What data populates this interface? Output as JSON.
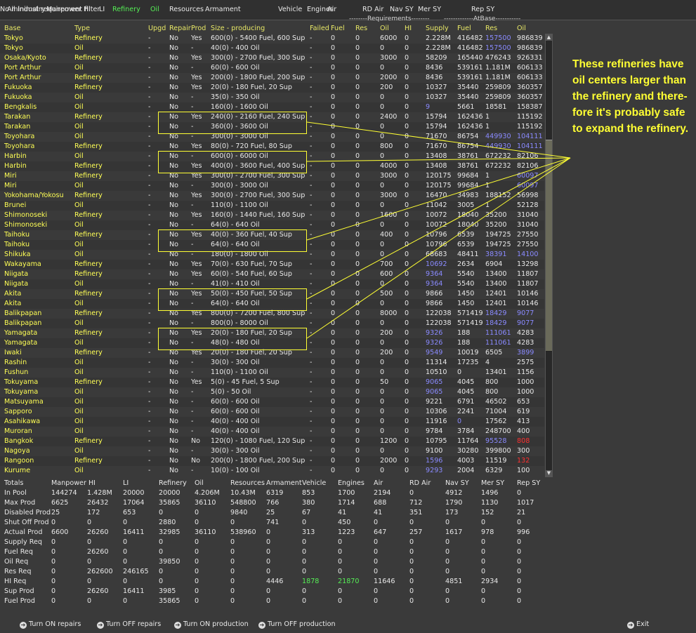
{
  "tabs": [
    "All Industry",
    "Manpower HI",
    "LI",
    "Refinery",
    "Oil",
    "Resources",
    "Armament",
    "Vehicle",
    "Engines",
    "Air",
    "RD Air",
    "Nav SY",
    "Mer SY",
    "Rep SY",
    "No minimal requirement filter"
  ],
  "requirements_header": "--------Requirements--------",
  "atbase_header": "-------------AtBase-----------",
  "columns": [
    "Base",
    "Type",
    "Upgd",
    "Repair",
    "Prod",
    "Size - producing",
    "Failed",
    "Fuel",
    "Res",
    "Oil",
    "HI",
    "Supply",
    "Fuel",
    "Res",
    "Oil"
  ],
  "rows": [
    [
      "Tokyo",
      "Refinery",
      "-",
      "No",
      "Yes",
      "600(0) - 5400 Fuel, 600 Sup",
      "-",
      "0",
      "0",
      "6000",
      "0",
      "2.228M",
      "416482",
      "157500",
      "986839"
    ],
    [
      "Tokyo",
      "Oil",
      "-",
      "No",
      "-",
      "40(0) - 400 Oil",
      "-",
      "0",
      "0",
      "0",
      "0",
      "2.228M",
      "416482",
      "157500",
      "986839"
    ],
    [
      "Osaka/Kyoto",
      "Refinery",
      "-",
      "No",
      "Yes",
      "300(0) - 2700 Fuel, 300 Sup",
      "-",
      "0",
      "0",
      "3000",
      "0",
      "58209",
      "165440",
      "476243",
      "926331"
    ],
    [
      "Port Arthur",
      "Oil",
      "-",
      "No",
      "-",
      "60(0) - 600 Oil",
      "-",
      "0",
      "0",
      "0",
      "0",
      "8436",
      "539161",
      "1.181M",
      "606133"
    ],
    [
      "Port Arthur",
      "Refinery",
      "-",
      "No",
      "Yes",
      "200(0) - 1800 Fuel, 200 Sup",
      "-",
      "0",
      "0",
      "2000",
      "0",
      "8436",
      "539161",
      "1.181M",
      "606133"
    ],
    [
      "Fukuoka",
      "Refinery",
      "-",
      "No",
      "Yes",
      "20(0) - 180 Fuel, 20 Sup",
      "-",
      "0",
      "0",
      "200",
      "0",
      "10327",
      "35440",
      "259809",
      "360357"
    ],
    [
      "Fukuoka",
      "Oil",
      "-",
      "No",
      "-",
      "35(0) - 350 Oil",
      "-",
      "0",
      "0",
      "0",
      "0",
      "10327",
      "35440",
      "259809",
      "360357"
    ],
    [
      "Bengkalis",
      "Oil",
      "-",
      "No",
      "-",
      "160(0) - 1600 Oil",
      "-",
      "0",
      "0",
      "0",
      "0",
      "9",
      "5661",
      "18581",
      "158387"
    ],
    [
      "Tarakan",
      "Refinery",
      "-",
      "No",
      "Yes",
      "240(0) - 2160 Fuel, 240 Sup",
      "-",
      "0",
      "0",
      "2400",
      "0",
      "15794",
      "162436",
      "1",
      "115192"
    ],
    [
      "Tarakan",
      "Oil",
      "-",
      "No",
      "-",
      "360(0) - 3600 Oil",
      "-",
      "0",
      "0",
      "0",
      "0",
      "15794",
      "162436",
      "1",
      "115192"
    ],
    [
      "Toyohara",
      "Oil",
      "-",
      "No",
      "-",
      "300(0) - 3000 Oil",
      "-",
      "0",
      "0",
      "0",
      "0",
      "71670",
      "86754",
      "449930",
      "104111"
    ],
    [
      "Toyohara",
      "Refinery",
      "-",
      "No",
      "Yes",
      "80(0) - 720 Fuel, 80 Sup",
      "-",
      "0",
      "0",
      "800",
      "0",
      "71670",
      "86754",
      "449930",
      "104111"
    ],
    [
      "Harbin",
      "Oil",
      "-",
      "No",
      "-",
      "600(0) - 6000 Oil",
      "-",
      "0",
      "0",
      "0",
      "0",
      "13408",
      "38761",
      "672232",
      "82106"
    ],
    [
      "Harbin",
      "Refinery",
      "-",
      "No",
      "Yes",
      "400(0) - 3600 Fuel, 400 Sup",
      "-",
      "0",
      "0",
      "4000",
      "0",
      "13408",
      "38761",
      "672232",
      "82106"
    ],
    [
      "Miri",
      "Refinery",
      "-",
      "No",
      "Yes",
      "300(0) - 2700 Fuel, 300 Sup",
      "-",
      "0",
      "0",
      "3000",
      "0",
      "120175",
      "99684",
      "1",
      "60097"
    ],
    [
      "Miri",
      "Oil",
      "-",
      "No",
      "-",
      "300(0) - 3000 Oil",
      "-",
      "0",
      "0",
      "0",
      "0",
      "120175",
      "99684",
      "1",
      "60097"
    ],
    [
      "Yokohama/Yokosu",
      "Refinery",
      "-",
      "No",
      "Yes",
      "300(0) - 2700 Fuel, 300 Sup",
      "-",
      "0",
      "0",
      "3000",
      "0",
      "16470",
      "34983",
      "188152",
      "56998"
    ],
    [
      "Brunei",
      "Oil",
      "-",
      "No",
      "-",
      "110(0) - 1100 Oil",
      "-",
      "0",
      "0",
      "0",
      "0",
      "11042",
      "3005",
      "1",
      "52128"
    ],
    [
      "Shimonoseki",
      "Refinery",
      "-",
      "No",
      "Yes",
      "160(0) - 1440 Fuel, 160 Sup",
      "-",
      "0",
      "0",
      "1600",
      "0",
      "10072",
      "18040",
      "35200",
      "31040"
    ],
    [
      "Shimonoseki",
      "Oil",
      "-",
      "No",
      "-",
      "64(0) - 640 Oil",
      "-",
      "0",
      "0",
      "0",
      "0",
      "10072",
      "18040",
      "35200",
      "31040"
    ],
    [
      "Taihoku",
      "Refinery",
      "-",
      "No",
      "Yes",
      "40(0) - 360 Fuel, 40 Sup",
      "-",
      "0",
      "0",
      "400",
      "0",
      "10796",
      "6539",
      "194725",
      "27550"
    ],
    [
      "Taihoku",
      "Oil",
      "-",
      "No",
      "-",
      "64(0) - 640 Oil",
      "-",
      "0",
      "0",
      "0",
      "0",
      "10796",
      "6539",
      "194725",
      "27550"
    ],
    [
      "Shikuka",
      "Oil",
      "-",
      "No",
      "-",
      "180(0) - 1800 Oil",
      "-",
      "0",
      "0",
      "0",
      "0",
      "68683",
      "48411",
      "38391",
      "14100"
    ],
    [
      "Wakayama",
      "Refinery",
      "-",
      "No",
      "Yes",
      "70(0) - 630 Fuel, 70 Sup",
      "-",
      "0",
      "0",
      "700",
      "0",
      "10692",
      "2634",
      "6904",
      "13298"
    ],
    [
      "Niigata",
      "Refinery",
      "-",
      "No",
      "Yes",
      "60(0) - 540 Fuel, 60 Sup",
      "-",
      "0",
      "0",
      "600",
      "0",
      "9364",
      "5540",
      "13400",
      "11807"
    ],
    [
      "Niigata",
      "Oil",
      "-",
      "No",
      "-",
      "41(0) - 410 Oil",
      "-",
      "0",
      "0",
      "0",
      "0",
      "9364",
      "5540",
      "13400",
      "11807"
    ],
    [
      "Akita",
      "Refinery",
      "-",
      "No",
      "Yes",
      "50(0) - 450 Fuel, 50 Sup",
      "-",
      "0",
      "0",
      "500",
      "0",
      "9866",
      "1450",
      "12401",
      "10146"
    ],
    [
      "Akita",
      "Oil",
      "-",
      "No",
      "-",
      "64(0) - 640 Oil",
      "-",
      "0",
      "0",
      "0",
      "0",
      "9866",
      "1450",
      "12401",
      "10146"
    ],
    [
      "Balikpapan",
      "Refinery",
      "-",
      "No",
      "Yes",
      "800(0) - 7200 Fuel, 800 Sup",
      "-",
      "0",
      "0",
      "8000",
      "0",
      "122038",
      "571419",
      "18429",
      "9077"
    ],
    [
      "Balikpapan",
      "Oil",
      "-",
      "No",
      "-",
      "800(0) - 8000 Oil",
      "-",
      "0",
      "0",
      "0",
      "0",
      "122038",
      "571419",
      "18429",
      "9077"
    ],
    [
      "Yamagata",
      "Refinery",
      "-",
      "No",
      "Yes",
      "20(0) - 180 Fuel, 20 Sup",
      "-",
      "0",
      "0",
      "200",
      "0",
      "9326",
      "188",
      "111061",
      "4283"
    ],
    [
      "Yamagata",
      "Oil",
      "-",
      "No",
      "-",
      "48(0) - 480 Oil",
      "-",
      "0",
      "0",
      "0",
      "0",
      "9326",
      "188",
      "111061",
      "4283"
    ],
    [
      "Iwaki",
      "Refinery",
      "-",
      "No",
      "Yes",
      "20(0) - 180 Fuel, 20 Sup",
      "-",
      "0",
      "0",
      "200",
      "0",
      "9549",
      "10019",
      "6505",
      "3899"
    ],
    [
      "Rashin",
      "Oil",
      "-",
      "No",
      "-",
      "30(0) - 300 Oil",
      "-",
      "0",
      "0",
      "0",
      "0",
      "11314",
      "17235",
      "4",
      "2575"
    ],
    [
      "Fushun",
      "Oil",
      "-",
      "No",
      "-",
      "110(0) - 1100 Oil",
      "-",
      "0",
      "0",
      "0",
      "0",
      "10510",
      "0",
      "13401",
      "1156"
    ],
    [
      "Tokuyama",
      "Refinery",
      "-",
      "No",
      "Yes",
      "5(0) - 45 Fuel, 5 Sup",
      "-",
      "0",
      "0",
      "50",
      "0",
      "9065",
      "4045",
      "800",
      "1000"
    ],
    [
      "Tokuyama",
      "Oil",
      "-",
      "No",
      "-",
      "5(0) - 50 Oil",
      "-",
      "0",
      "0",
      "0",
      "0",
      "9065",
      "4045",
      "800",
      "1000"
    ],
    [
      "Matsuyama",
      "Oil",
      "-",
      "No",
      "-",
      "60(0) - 600 Oil",
      "-",
      "0",
      "0",
      "0",
      "0",
      "9221",
      "6791",
      "46502",
      "653"
    ],
    [
      "Sapporo",
      "Oil",
      "-",
      "No",
      "-",
      "60(0) - 600 Oil",
      "-",
      "0",
      "0",
      "0",
      "0",
      "10306",
      "2241",
      "71004",
      "619"
    ],
    [
      "Asahikawa",
      "Oil",
      "-",
      "No",
      "-",
      "40(0) - 400 Oil",
      "-",
      "0",
      "0",
      "0",
      "0",
      "11916",
      "0",
      "17562",
      "413"
    ],
    [
      "Muroran",
      "Oil",
      "-",
      "No",
      "-",
      "40(0) - 400 Oil",
      "-",
      "0",
      "0",
      "0",
      "0",
      "9784",
      "3784",
      "248700",
      "400"
    ],
    [
      "Bangkok",
      "Refinery",
      "-",
      "No",
      "No",
      "120(0) - 1080 Fuel, 120 Sup",
      "-",
      "0",
      "0",
      "1200",
      "0",
      "10795",
      "11764",
      "95528",
      "808"
    ],
    [
      "Nagoya",
      "Oil",
      "-",
      "No",
      "-",
      "30(0) - 300 Oil",
      "-",
      "0",
      "0",
      "0",
      "0",
      "9100",
      "30280",
      "399800",
      "300"
    ],
    [
      "Rangoon",
      "Refinery",
      "-",
      "No",
      "No",
      "200(0) - 1800 Fuel, 200 Sup",
      "-",
      "0",
      "0",
      "2000",
      "0",
      "1596",
      "4003",
      "11519",
      "132"
    ],
    [
      "Kurume",
      "Oil",
      "-",
      "No",
      "-",
      "10(0) - 100 Oil",
      "-",
      "0",
      "0",
      "0",
      "0",
      "9293",
      "2004",
      "6329",
      "100"
    ]
  ],
  "blue_cells": [
    [
      7,
      11
    ],
    [
      30,
      11
    ],
    [
      31,
      11
    ],
    [
      32,
      11
    ],
    [
      35,
      11
    ],
    [
      36,
      11
    ],
    [
      43,
      11
    ],
    [
      44,
      11
    ],
    [
      23,
      11
    ],
    [
      24,
      11
    ],
    [
      25,
      11
    ],
    [
      39,
      12
    ],
    [
      0,
      13
    ],
    [
      1,
      13
    ],
    [
      10,
      13
    ],
    [
      11,
      13
    ],
    [
      22,
      13
    ],
    [
      28,
      13
    ],
    [
      29,
      13
    ],
    [
      30,
      13
    ],
    [
      31,
      13
    ],
    [
      41,
      13
    ],
    [
      10,
      14
    ],
    [
      11,
      14
    ],
    [
      14,
      14
    ],
    [
      15,
      14
    ],
    [
      22,
      14
    ],
    [
      28,
      14
    ],
    [
      29,
      14
    ],
    [
      32,
      14
    ]
  ],
  "red_cells": [
    [
      41,
      14
    ],
    [
      43,
      14
    ]
  ],
  "totals_columns": [
    "Totals",
    "Manpower HI",
    "LI",
    "Refinery",
    "Oil",
    "Resources",
    "Armament",
    "Vehicle",
    "Engines",
    "Air",
    "RD Air",
    "Nav SY",
    "Mer SY",
    "Rep SY"
  ],
  "totals_rows": [
    [
      "In Pool",
      "144274",
      "1.428M",
      "20000",
      "20000",
      "4.206M",
      "10.43M",
      "6319",
      "853",
      "1700",
      "2194",
      "0",
      "4912",
      "1496",
      "0"
    ],
    [
      "Max Prod",
      "6625",
      "26432",
      "17064",
      "35865",
      "36110",
      "548800",
      "766",
      "380",
      "1714",
      "688",
      "712",
      "1790",
      "1130",
      "1017"
    ],
    [
      "Disabled Prod",
      "25",
      "172",
      "653",
      "0",
      "0",
      "9840",
      "25",
      "67",
      "41",
      "41",
      "351",
      "173",
      "152",
      "21"
    ],
    [
      "Shut Off Prod",
      "0",
      "0",
      "0",
      "2880",
      "0",
      "0",
      "741",
      "0",
      "450",
      "0",
      "0",
      "0",
      "0",
      "0"
    ],
    [
      "Actual Prod",
      "6600",
      "26260",
      "16411",
      "32985",
      "36110",
      "538960",
      "0",
      "313",
      "1223",
      "647",
      "257",
      "1617",
      "978",
      "996"
    ],
    [
      "Supply Req",
      "0",
      "0",
      "0",
      "0",
      "0",
      "0",
      "0",
      "0",
      "0",
      "0",
      "0",
      "0",
      "0",
      "0"
    ],
    [
      "Fuel Req",
      "0",
      "26260",
      "0",
      "0",
      "0",
      "0",
      "0",
      "0",
      "0",
      "0",
      "0",
      "0",
      "0",
      "0"
    ],
    [
      "Oil Req",
      "0",
      "0",
      "0",
      "39850",
      "0",
      "0",
      "0",
      "0",
      "0",
      "0",
      "0",
      "0",
      "0",
      "0"
    ],
    [
      "Res Req",
      "0",
      "262600",
      "246165",
      "0",
      "0",
      "0",
      "0",
      "0",
      "0",
      "0",
      "0",
      "0",
      "0",
      "0"
    ],
    [
      "HI Req",
      "0",
      "0",
      "0",
      "0",
      "0",
      "0",
      "4446",
      "1878",
      "21870",
      "11646",
      "0",
      "4851",
      "2934",
      "0"
    ],
    [
      "Sup Prod",
      "0",
      "26260",
      "16411",
      "3985",
      "0",
      "0",
      "0",
      "0",
      "0",
      "0",
      "0",
      "0",
      "0",
      "0"
    ],
    [
      "Fuel Prod",
      "0",
      "0",
      "0",
      "35865",
      "0",
      "0",
      "0",
      "0",
      "0",
      "0",
      "0",
      "0",
      "0",
      "0"
    ]
  ],
  "annotation": "These refineries have oil centers larger than the refinery and there-fore it's probably safe to expand the refinery.",
  "buttons": {
    "repairs_on": "Turn ON repairs",
    "repairs_off": "Turn OFF repairs",
    "prod_on": "Turn ON production",
    "prod_off": "Turn OFF production",
    "exit": "Exit"
  },
  "colors": {
    "background": "#3a3a3a",
    "highlight": "#ffff33",
    "yellow_text": "#ffff55",
    "blue_value": "#8a8aff",
    "red_value": "#ff3030",
    "green_value": "#55ee55"
  }
}
